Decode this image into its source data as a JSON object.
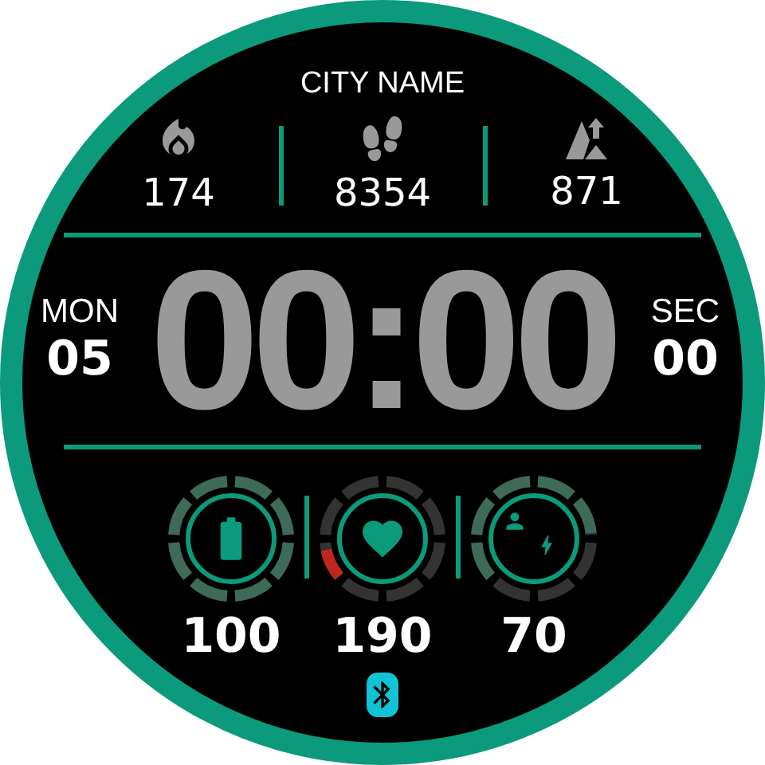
{
  "city": "CITY NAME",
  "stats": [
    {
      "kind": "calories",
      "value": "174"
    },
    {
      "kind": "steps",
      "value": "8354"
    },
    {
      "kind": "elevation",
      "value": "871"
    }
  ],
  "date": {
    "weekday": "MON",
    "day": "05"
  },
  "time": "00:00",
  "seconds": {
    "label": "SEC",
    "value": "00"
  },
  "gauges": [
    {
      "kind": "battery",
      "color": "#3d6b57",
      "value": "100"
    },
    {
      "kind": "heart",
      "color": "#c0261c",
      "value": "190"
    },
    {
      "kind": "activity",
      "color": "#3d6b57",
      "value": "70"
    }
  ],
  "bluetooth": {
    "on": true
  }
}
